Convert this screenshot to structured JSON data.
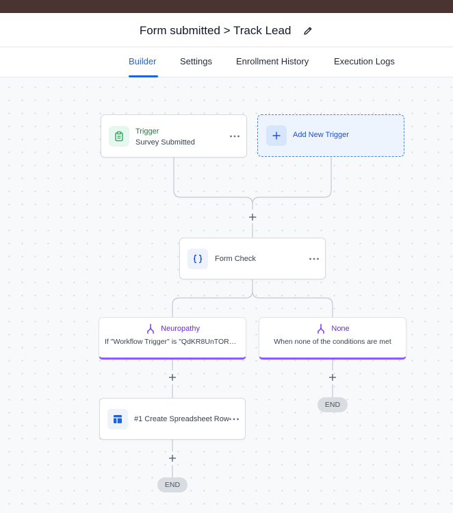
{
  "header": {
    "title": "Form submitted > Track Lead"
  },
  "tabs": [
    {
      "label": "Builder",
      "active": true
    },
    {
      "label": "Settings",
      "active": false
    },
    {
      "label": "Enrollment History",
      "active": false
    },
    {
      "label": "Execution Logs",
      "active": false
    }
  ],
  "colors": {
    "accent": "#1d64d8",
    "trigger_green": "#15803d",
    "branch_purple": "#8b5cf6",
    "topbar": "#4a3432"
  },
  "workflow": {
    "trigger": {
      "title": "Trigger",
      "subtitle": "Survey Submitted",
      "icon": "clipboard-icon"
    },
    "add_trigger": {
      "label": "Add New Trigger",
      "icon": "plus-icon"
    },
    "form_check": {
      "label": "Form Check",
      "icon": "braces-icon"
    },
    "branches": [
      {
        "name": "Neuropathy",
        "condition": "If \"Workflow Trigger\" is \"QdKR8UnTORG...",
        "icon": "branch-icon"
      },
      {
        "name": "None",
        "condition": "When none of the conditions are met",
        "icon": "branch-icon"
      }
    ],
    "action": {
      "label": "#1 Create Spreadsheet Row",
      "icon": "spreadsheet-icon"
    },
    "end_label": "END"
  }
}
